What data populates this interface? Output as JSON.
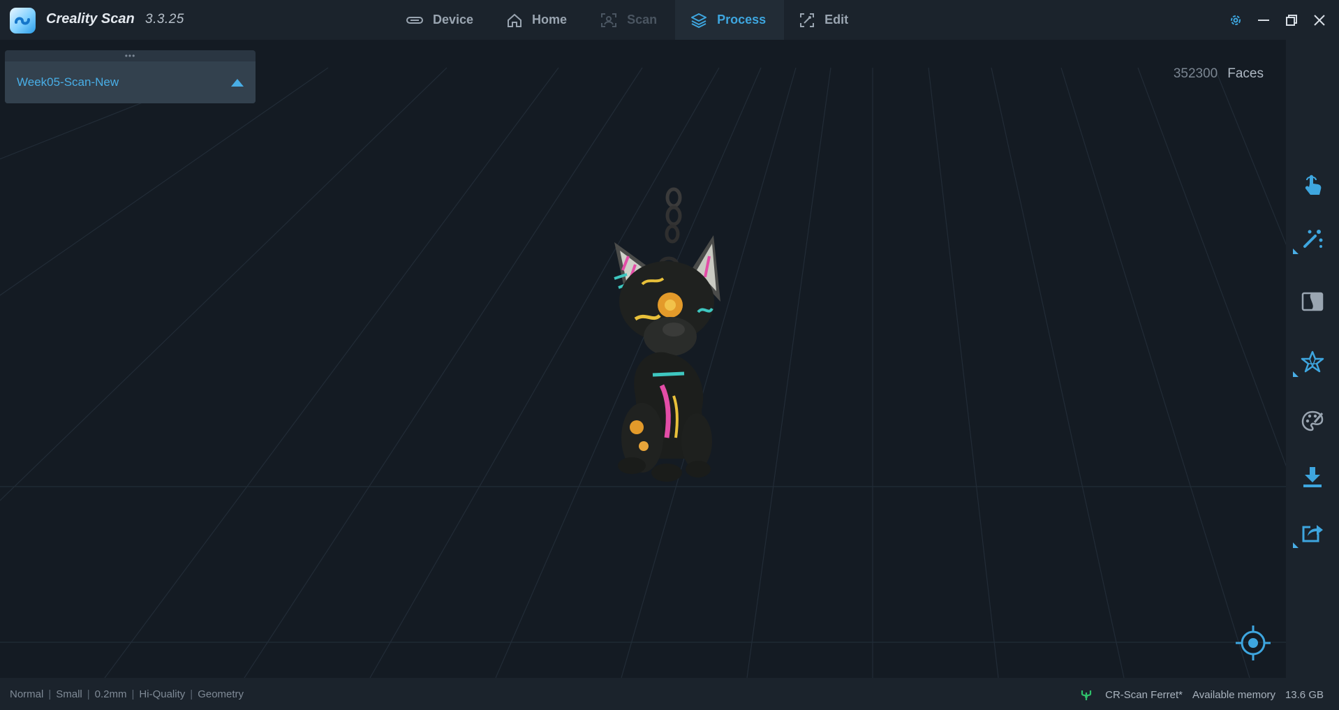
{
  "app": {
    "name": "Creality Scan",
    "version": "3.3.25"
  },
  "nav": {
    "tabs": [
      {
        "label": "Device",
        "icon": "device-icon",
        "state": "normal"
      },
      {
        "label": "Home",
        "icon": "home-icon",
        "state": "normal"
      },
      {
        "label": "Scan",
        "icon": "scan-icon",
        "state": "disabled"
      },
      {
        "label": "Process",
        "icon": "layers-icon",
        "state": "active"
      },
      {
        "label": "Edit",
        "icon": "edit-icon",
        "state": "normal"
      }
    ]
  },
  "window_controls": [
    "settings-icon",
    "minimize-icon",
    "restore-icon",
    "close-icon"
  ],
  "project_panel": {
    "handle": "•••",
    "project_name": "Week05-Scan-New"
  },
  "viewport": {
    "faces_count": "352300",
    "faces_label": "Faces"
  },
  "side_toolbar": {
    "tools": [
      {
        "icon": "touch-select-icon",
        "has_submenu": false
      },
      {
        "icon": "magic-wand-icon",
        "has_submenu": true
      },
      {
        "icon": "mesh-flip-icon",
        "has_submenu": false
      },
      {
        "icon": "star-mesh-icon",
        "has_submenu": true
      },
      {
        "icon": "palette-icon",
        "has_submenu": false
      },
      {
        "icon": "download-icon",
        "has_submenu": false
      },
      {
        "icon": "export-share-icon",
        "has_submenu": true
      }
    ]
  },
  "status": {
    "mode": "Normal",
    "size": "Small",
    "resolution": "0.2mm",
    "quality": "Hi-Quality",
    "type": "Geometry",
    "device": "CR-Scan Ferret*",
    "memory_label": "Available memory",
    "memory_value": "13.6 GB"
  },
  "colors": {
    "accent": "#3ea6df",
    "background": "#141b23",
    "panel": "#1b232c"
  }
}
